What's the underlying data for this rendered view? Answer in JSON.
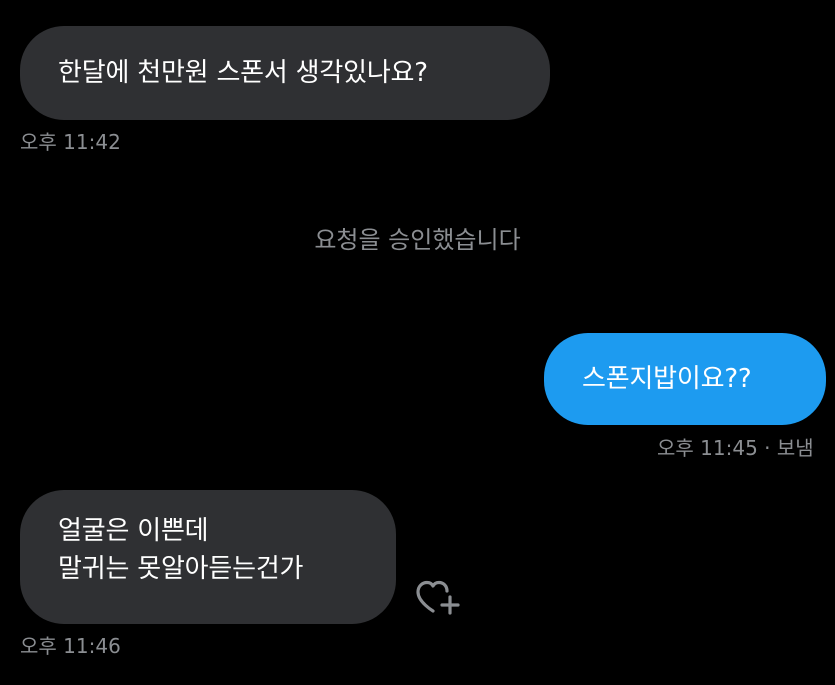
{
  "conversation": {
    "messages": [
      {
        "direction": "incoming",
        "lines": [
          "한달에 천만원 스폰서 생각있나요?"
        ],
        "time": "오후 11:42"
      },
      {
        "direction": "outgoing",
        "lines": [
          "스폰지밥이요??"
        ],
        "time": "오후 11:45 · 보냄"
      },
      {
        "direction": "incoming",
        "lines": [
          "얼굴은 이쁜데",
          "말귀는 못알아듣는건가"
        ],
        "time": "오후 11:46"
      }
    ],
    "system_notice": "요청을 승인했습니다"
  },
  "icons": {
    "reaction": "heart-plus-icon"
  },
  "colors": {
    "background": "#000000",
    "incoming_bubble": "#2f3033",
    "outgoing_bubble": "#1d9bf0",
    "meta_text": "#8b8e92",
    "bubble_text": "#ffffff"
  }
}
